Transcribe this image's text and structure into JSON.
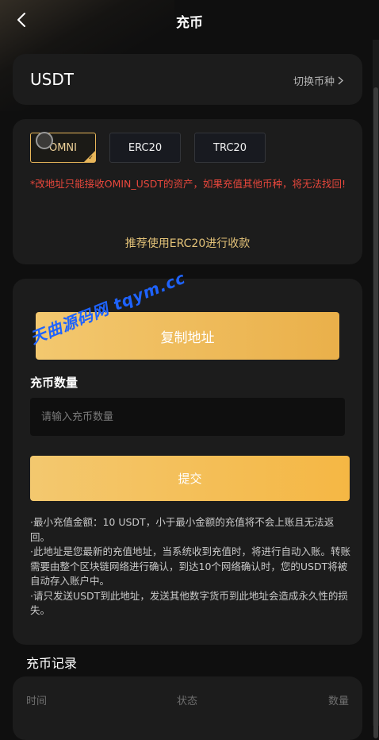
{
  "header": {
    "title": "充币",
    "back_icon": "chevron-left-icon"
  },
  "coin": {
    "name": "USDT",
    "switch_label": "切换币种"
  },
  "network": {
    "chains": [
      {
        "label": "OMNI",
        "selected": true
      },
      {
        "label": "ERC20",
        "selected": false
      },
      {
        "label": "TRC20",
        "selected": false
      }
    ],
    "warning": "*改地址只能接收OMIN_USDT的资产，如果充值其他币种，将无法找回!",
    "recommend": "推荐使用ERC20进行收款"
  },
  "deposit": {
    "copy_label": "复制地址",
    "amount_label": "充币数量",
    "amount_placeholder": "请输入充币数量",
    "amount_value": "",
    "submit_label": "提交",
    "notes": [
      "·最小充值金额：10 USDT，小于最小金额的充值将不会上账且无法返回。",
      "·此地址是您最新的充值地址，当系统收到充值时，将进行自动入账。转账需要由整个区块链网络进行确认，到达10个网络确认时，您的USDT将被自动存入账户中。",
      "·请只发送USDT到此地址，发送其他数字货币到此地址会造成永久性的损失。"
    ]
  },
  "watermark": "天曲源码网 tqym.cc",
  "records": {
    "title": "充币记录",
    "columns": [
      "时间",
      "状态",
      "数量"
    ]
  },
  "colors": {
    "background": "#0f0f0f",
    "card": "#1c1c1c",
    "accent_gold": "#eab04a",
    "warning_red": "#e8473c",
    "recommend_gold": "#e3c278"
  }
}
